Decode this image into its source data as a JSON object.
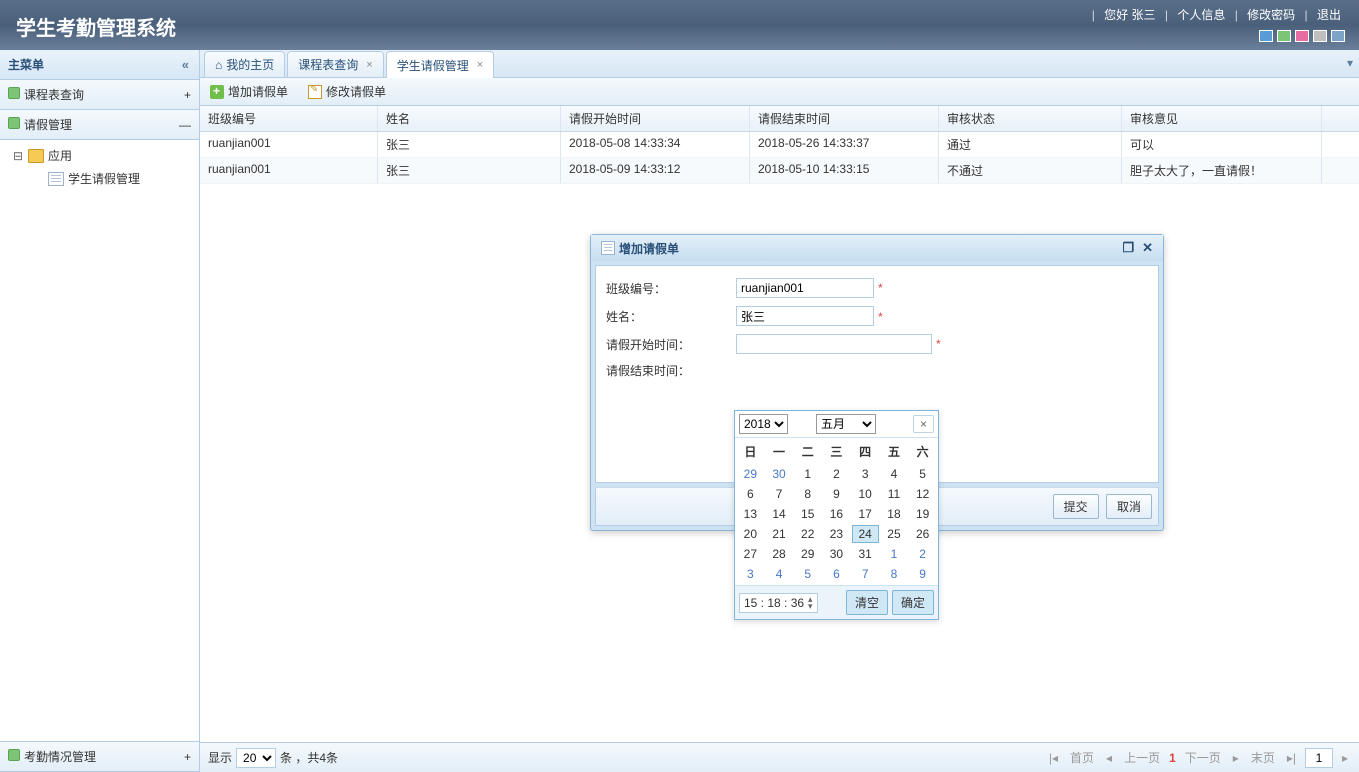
{
  "header": {
    "title": "学生考勤管理系统",
    "greeting": "您好 张三",
    "links": {
      "profile": "个人信息",
      "password": "修改密码",
      "logout": "退出"
    },
    "swatches": [
      "#5a9bd5",
      "#7cc576",
      "#e86ca4",
      "#bfbfbf",
      "#7da4c7"
    ]
  },
  "sidebar": {
    "title": "主菜单",
    "items": [
      {
        "label": "课程表查询",
        "expanded": false
      },
      {
        "label": "请假管理",
        "expanded": true,
        "tree": {
          "root": "应用",
          "children": [
            "学生请假管理"
          ]
        }
      },
      {
        "label": "考勤情况管理",
        "expanded": false
      }
    ]
  },
  "tabs": [
    {
      "label": "我的主页",
      "home": true,
      "closable": false
    },
    {
      "label": "课程表查询",
      "closable": true
    },
    {
      "label": "学生请假管理",
      "closable": true,
      "active": true
    }
  ],
  "toolbar": {
    "add": "增加请假单",
    "edit": "修改请假单"
  },
  "grid": {
    "columns": [
      "班级编号",
      "姓名",
      "请假开始时间",
      "请假结束时间",
      "审核状态",
      "审核意见"
    ],
    "widths": [
      178,
      183,
      189,
      189,
      183,
      200
    ],
    "rows": [
      [
        "ruanjian001",
        "张三",
        "2018-05-08 14:33:34",
        "2018-05-26 14:33:37",
        "通过",
        "可以"
      ],
      [
        "ruanjian001",
        "张三",
        "2018-05-09 14:33:12",
        "2018-05-10 14:33:15",
        "不通过",
        "胆子太大了，一直请假！"
      ]
    ]
  },
  "pager": {
    "show_label": "显示",
    "page_size": "20",
    "unit_suffix": "条 ，共4条",
    "first": "首页",
    "prev": "上一页",
    "next": "下一页",
    "last": "末页",
    "current": "1",
    "page_input": "1"
  },
  "dialog": {
    "title": "增加请假单",
    "fields": {
      "class_label": "班级编号：",
      "class_value": "ruanjian001",
      "name_label": "姓名：",
      "name_value": "张三",
      "start_label": "请假开始时间：",
      "start_value": "",
      "end_label": "请假结束时间："
    },
    "submit": "提交",
    "cancel": "取消"
  },
  "datepicker": {
    "year": "2018",
    "month": "五月",
    "weekdays": [
      "日",
      "一",
      "二",
      "三",
      "四",
      "五",
      "六"
    ],
    "weeks": [
      [
        {
          "d": 29,
          "o": true
        },
        {
          "d": 30,
          "o": true
        },
        {
          "d": 1
        },
        {
          "d": 2
        },
        {
          "d": 3
        },
        {
          "d": 4
        },
        {
          "d": 5
        }
      ],
      [
        {
          "d": 6
        },
        {
          "d": 7
        },
        {
          "d": 8
        },
        {
          "d": 9
        },
        {
          "d": 10
        },
        {
          "d": 11
        },
        {
          "d": 12
        }
      ],
      [
        {
          "d": 13
        },
        {
          "d": 14
        },
        {
          "d": 15
        },
        {
          "d": 16
        },
        {
          "d": 17
        },
        {
          "d": 18
        },
        {
          "d": 19
        }
      ],
      [
        {
          "d": 20
        },
        {
          "d": 21
        },
        {
          "d": 22
        },
        {
          "d": 23
        },
        {
          "d": 24,
          "t": true
        },
        {
          "d": 25
        },
        {
          "d": 26
        }
      ],
      [
        {
          "d": 27
        },
        {
          "d": 28
        },
        {
          "d": 29
        },
        {
          "d": 30
        },
        {
          "d": 31
        },
        {
          "d": 1,
          "o": true
        },
        {
          "d": 2,
          "o": true
        }
      ],
      [
        {
          "d": 3,
          "o": true
        },
        {
          "d": 4,
          "o": true
        },
        {
          "d": 5,
          "o": true
        },
        {
          "d": 6,
          "o": true
        },
        {
          "d": 7,
          "o": true
        },
        {
          "d": 8,
          "o": true
        },
        {
          "d": 9,
          "o": true
        }
      ]
    ],
    "time": "15 : 18 : 36",
    "clear": "清空",
    "ok": "确定",
    "close": "×"
  }
}
